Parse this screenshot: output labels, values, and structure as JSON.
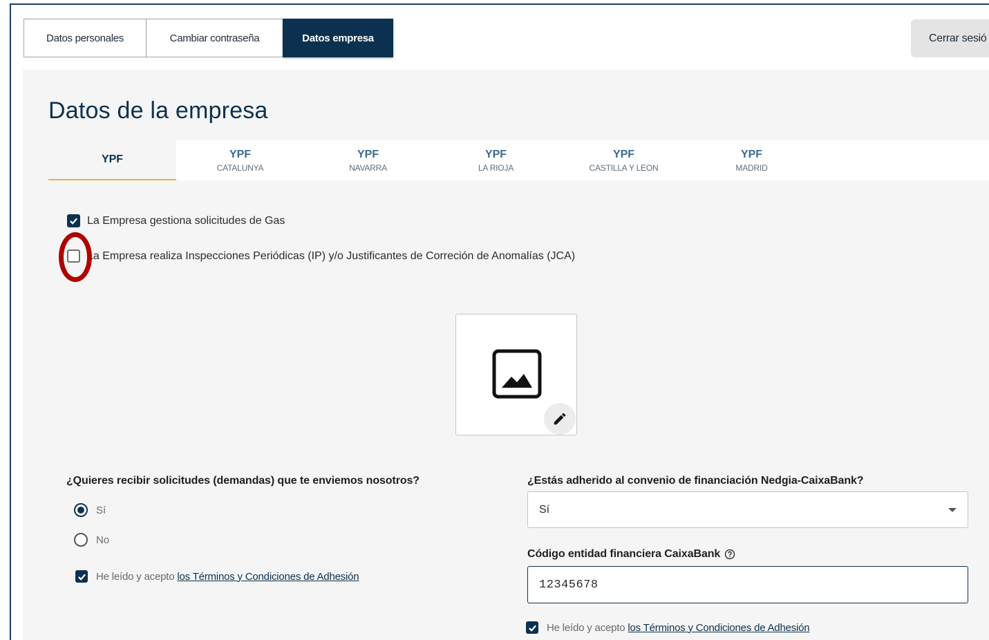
{
  "top_tabs": [
    {
      "label": "Datos personales"
    },
    {
      "label": "Cambiar contraseña"
    },
    {
      "label": "Datos empresa"
    }
  ],
  "logout_label": "Cerrar sesió",
  "page_title": "Datos de la empresa",
  "company_tabs": [
    {
      "name": "YPF",
      "sub": ""
    },
    {
      "name": "YPF",
      "sub": "CATALUNYA"
    },
    {
      "name": "YPF",
      "sub": "NAVARRA"
    },
    {
      "name": "YPF",
      "sub": "LA RIOJA"
    },
    {
      "name": "YPF",
      "sub": "CASTILLA Y LEON"
    },
    {
      "name": "YPF",
      "sub": "MADRID"
    }
  ],
  "checkboxes": {
    "gas": {
      "label": "La Empresa gestiona solicitudes de Gas",
      "checked": true
    },
    "inspections": {
      "label": "La Empresa realiza Inspecciones Periódicas (IP) y/o Justificantes de Correción de Anomalías (JCA)",
      "checked": false
    }
  },
  "demands": {
    "question": "¿Quieres recibir solicitudes (demandas) que te enviemos nosotros?",
    "options": [
      "Sí",
      "No"
    ],
    "selected": "Sí",
    "terms_prefix": "He leído y acepto",
    "terms_link": "los Términos y Condiciones de Adhesión",
    "terms_checked": true
  },
  "financing": {
    "question": "¿Estás adherido al convenio de financiación Nedgia-CaixaBank?",
    "selected": "Sí",
    "code_label": "Código entidad financiera CaixaBank",
    "code_value": "12345678",
    "terms_prefix": "He leído y acepto",
    "terms_link": "los Términos y Condiciones de Adhesión",
    "terms_checked": true
  },
  "colors": {
    "primary": "#0c3150",
    "highlight": "#b00000",
    "tab_underline": "#e6b340"
  },
  "icons": [
    "image-placeholder-icon",
    "edit-pencil-icon",
    "help-icon",
    "check-icon",
    "dropdown-caret-icon"
  ]
}
